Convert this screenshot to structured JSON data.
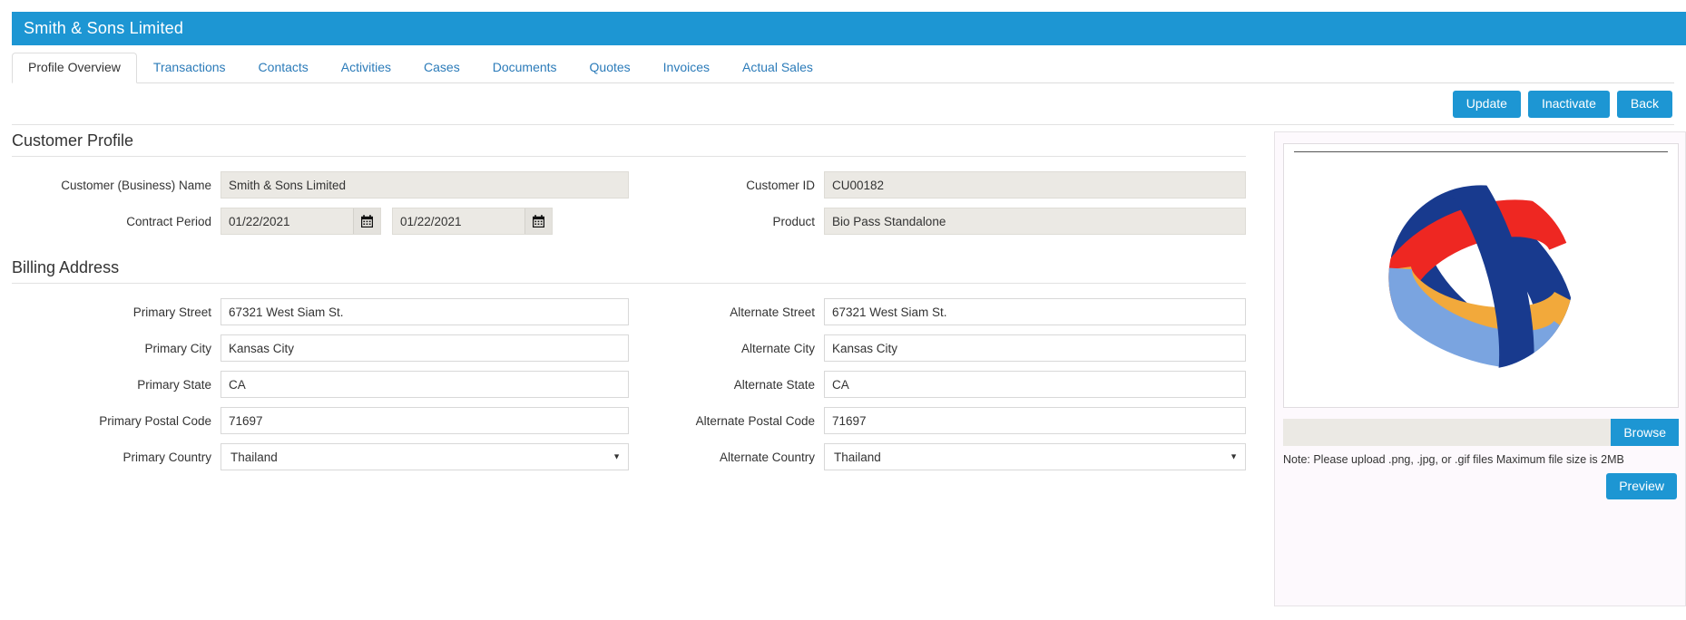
{
  "header": {
    "title": "Smith & Sons Limited",
    "accent_color": "#1d96d3"
  },
  "tabs": [
    {
      "label": "Profile Overview",
      "active": true
    },
    {
      "label": "Transactions",
      "active": false
    },
    {
      "label": "Contacts",
      "active": false
    },
    {
      "label": "Activities",
      "active": false
    },
    {
      "label": "Cases",
      "active": false
    },
    {
      "label": "Documents",
      "active": false
    },
    {
      "label": "Quotes",
      "active": false
    },
    {
      "label": "Invoices",
      "active": false
    },
    {
      "label": "Actual Sales",
      "active": false
    }
  ],
  "actions": {
    "update_label": "Update",
    "inactivate_label": "Inactivate",
    "back_label": "Back"
  },
  "customer_profile": {
    "section_title": "Customer Profile",
    "business_name_label": "Customer (Business) Name",
    "business_name_value": "Smith & Sons Limited",
    "contract_period_label": "Contract Period",
    "contract_start_value": "01/22/2021",
    "contract_end_value": "01/22/2021",
    "customer_id_label": "Customer ID",
    "customer_id_value": "CU00182",
    "product_label": "Product",
    "product_value": "Bio Pass Standalone"
  },
  "billing_address": {
    "section_title": "Billing Address",
    "primary_street_label": "Primary Street",
    "primary_street_value": "67321 West Siam St.",
    "primary_city_label": "Primary City",
    "primary_city_value": "Kansas City",
    "primary_state_label": "Primary State",
    "primary_state_value": "CA",
    "primary_postal_label": "Primary Postal Code",
    "primary_postal_value": "71697",
    "primary_country_label": "Primary Country",
    "primary_country_value": "Thailand",
    "alternate_street_label": "Alternate Street",
    "alternate_street_value": "67321 West Siam St.",
    "alternate_city_label": "Alternate City",
    "alternate_city_value": "Kansas City",
    "alternate_state_label": "Alternate State",
    "alternate_state_value": "CA",
    "alternate_postal_label": "Alternate Postal Code",
    "alternate_postal_value": "71697",
    "alternate_country_label": "Alternate Country",
    "alternate_country_value": "Thailand"
  },
  "upload_panel": {
    "file_input_value": "",
    "browse_label": "Browse",
    "note": "Note: Please upload .png, .jpg, or .gif files Maximum file size is 2MB",
    "preview_label": "Preview",
    "logo_colors": {
      "red": "#ee2722",
      "dark_blue": "#183a8e",
      "orange": "#f2a93b",
      "light_blue": "#7aa4e0"
    }
  },
  "icons": {
    "calendar": "calendar-icon",
    "caret_down": "chevron-down-icon"
  }
}
